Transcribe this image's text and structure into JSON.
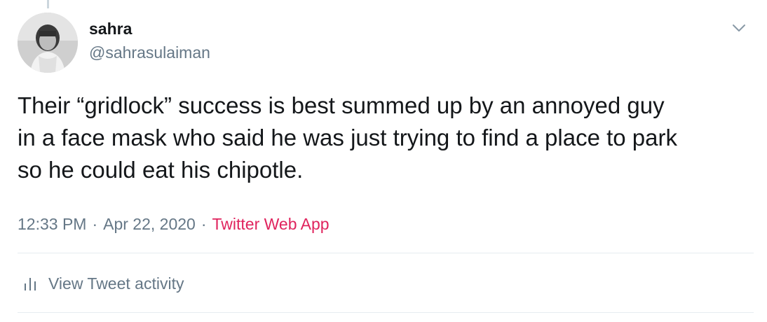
{
  "tweet": {
    "author": {
      "display_name": "sahra",
      "handle": "@sahrasulaiman"
    },
    "text": "Their “gridlock” success is best summed up by an annoyed guy\nin a face mask who said he was just trying to find a place to park\nso he could eat his chipotle.",
    "time": "12:33 PM",
    "date": "Apr 22, 2020",
    "separator": "·",
    "source": "Twitter Web App",
    "activity_label": "View Tweet activity"
  },
  "icons": {
    "menu_caret": "chevron-down-icon",
    "activity": "bar-chart-icon"
  },
  "colors": {
    "text_primary": "#14171a",
    "text_secondary": "#657786",
    "source_link": "#e0245e",
    "divider": "#e6ecf0"
  }
}
